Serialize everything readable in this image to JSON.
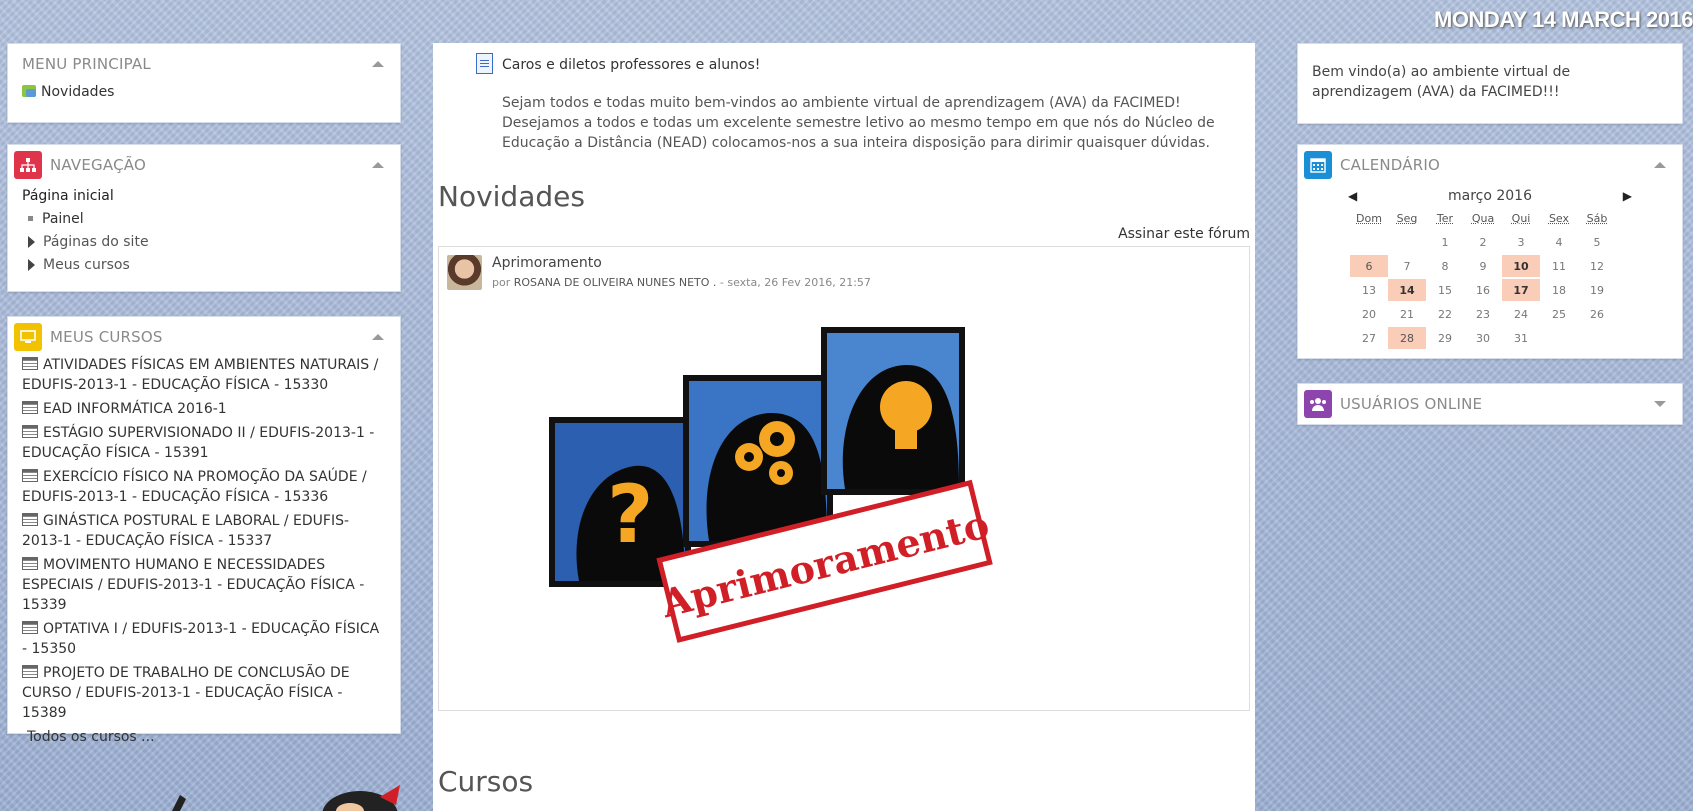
{
  "date": "MONDAY 14 MARCH 2016",
  "menu_principal": {
    "title": "MENU PRINCIPAL",
    "items": [
      {
        "label": "Novidades",
        "icon": "forum-icon"
      }
    ]
  },
  "navegacao": {
    "title": "NAVEGAÇÃO",
    "home": "Página inicial",
    "items": [
      "Painel",
      "Páginas do site",
      "Meus cursos"
    ]
  },
  "meus_cursos": {
    "title": "MEUS CURSOS",
    "courses": [
      "ATIVIDADES FÍSICAS EM AMBIENTES NATURAIS / EDUFIS-2013-1 - EDUCAÇÃO FÍSICA - 15330",
      "EAD INFORMÁTICA 2016-1",
      "ESTÁGIO SUPERVISIONADO II / EDUFIS-2013-1 - EDUCAÇÃO FÍSICA - 15391",
      "EXERCÍCIO FÍSICO NA PROMOÇÃO DA SAÚDE / EDUFIS-2013-1 - EDUCAÇÃO FÍSICA - 15336",
      "GINÁSTICA POSTURAL E LABORAL / EDUFIS-2013-1 - EDUCAÇÃO FÍSICA - 15337",
      "MOVIMENTO HUMANO E NECESSIDADES ESPECIAIS / EDUFIS-2013-1 - EDUCAÇÃO FÍSICA - 15339",
      "OPTATIVA I / EDUFIS-2013-1 - EDUCAÇÃO FÍSICA - 15350",
      "PROJETO DE TRABALHO DE CONCLUSÃO DE CURSO / EDUFIS-2013-1 - EDUCAÇÃO FÍSICA - 15389"
    ],
    "all_courses": "Todos os cursos ..."
  },
  "center": {
    "intro_title": "Caros e diletos professores e alunos!",
    "intro_text": "Sejam todos e todas muito bem-vindos ao ambiente virtual de aprendizagem (AVA) da FACIMED! Desejamos a todos e todas um excelente semestre letivo ao mesmo tempo em que nós do Núcleo de Educação a Distância (NEAD) colocamos-nos a sua inteira disposição para dirimir quaisquer dúvidas.",
    "news_heading": "Novidades",
    "subscribe": "Assinar este fórum",
    "post": {
      "subject": "Aprimoramento",
      "by": "por",
      "author": "ROSANA DE OLIVEIRA NUNES NETO .",
      "date": " - sexta, 26 Fev 2016, 21:57",
      "image_stamp": "Aprimoramento"
    },
    "courses_heading": "Cursos"
  },
  "welcome": {
    "text": "Bem vindo(a) ao ambiente virtual de aprendizagem (AVA) da FACIMED!!!"
  },
  "calendario": {
    "title": "CALENDÁRIO",
    "month": "março 2016",
    "prev": "◀",
    "next": "▶",
    "weekdays": [
      "Dom",
      "Seg",
      "Ter",
      "Qua",
      "Qui",
      "Sex",
      "Sáb"
    ],
    "weeks": [
      [
        "",
        "",
        "1",
        "2",
        "3",
        "4",
        "5"
      ],
      [
        "6",
        "7",
        "8",
        "9",
        "10",
        "11",
        "12"
      ],
      [
        "13",
        "14",
        "15",
        "16",
        "17",
        "18",
        "19"
      ],
      [
        "20",
        "21",
        "22",
        "23",
        "24",
        "25",
        "26"
      ],
      [
        "27",
        "28",
        "29",
        "30",
        "31",
        "",
        ""
      ]
    ],
    "event_days": [
      "6",
      "10",
      "14",
      "17",
      "28"
    ],
    "event_color": "#f9cdb8"
  },
  "usuarios_online": {
    "title": "USUÁRIOS ONLINE"
  },
  "colors": {
    "nav_icon": "#e0344a",
    "courses_icon": "#f2c200",
    "calendar_icon": "#1b8fd6",
    "online_icon": "#8e44ad"
  }
}
